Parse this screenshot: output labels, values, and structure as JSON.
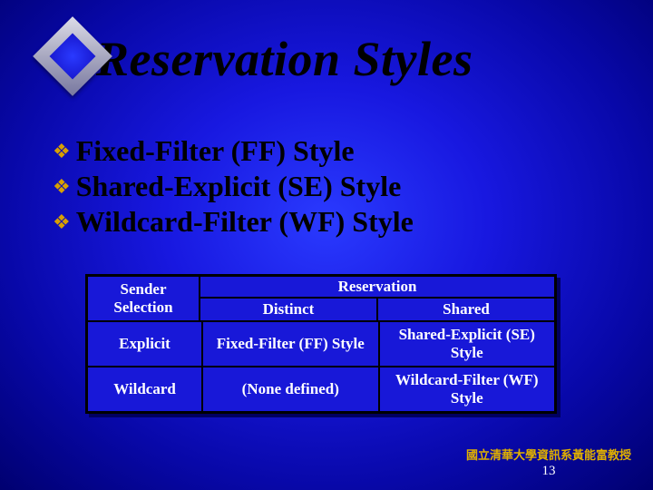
{
  "title": "Reservation Styles",
  "bullets": [
    "Fixed-Filter (FF) Style",
    "Shared-Explicit (SE) Style",
    "Wildcard-Filter (WF) Style"
  ],
  "table": {
    "corner_line1": "Sender",
    "corner_line2": "Selection",
    "header_span": "Reservation",
    "col1": "Distinct",
    "col2": "Shared",
    "rows": [
      {
        "label": "Explicit",
        "c1": "Fixed-Filter (FF) Style",
        "c2": "Shared-Explicit (SE) Style"
      },
      {
        "label": "Wildcard",
        "c1": "(None defined)",
        "c2": "Wildcard-Filter (WF) Style"
      }
    ]
  },
  "footer": {
    "credit": "國立清華大學資訊系黃能富教授",
    "page": "13"
  }
}
